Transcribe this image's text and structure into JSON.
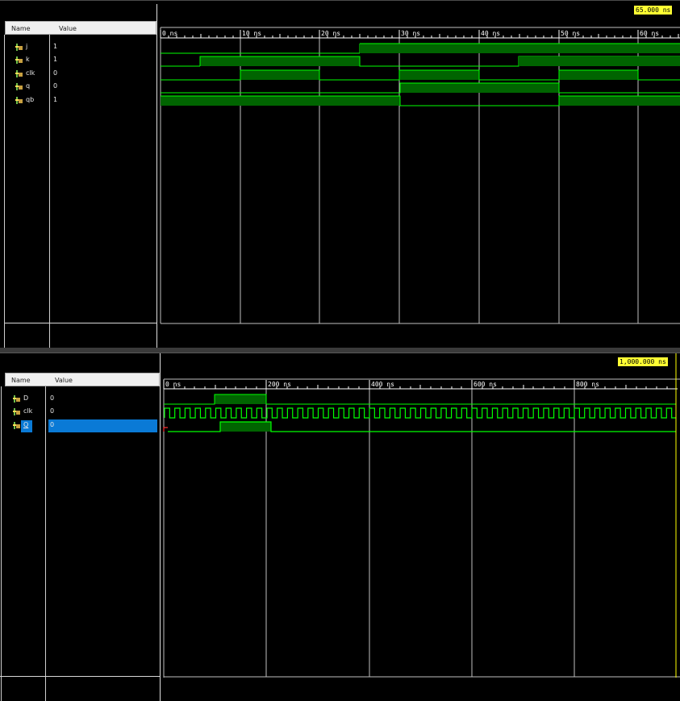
{
  "jk_panel": {
    "headers": {
      "name": "Name",
      "value": "Value"
    },
    "cursor_label": "65.000 ns",
    "time_ticks": [
      "0 ns",
      "10 ns",
      "20 ns",
      "30 ns",
      "40 ns",
      "50 ns",
      "60 ns"
    ],
    "signals": [
      {
        "name": "j",
        "value": "1"
      },
      {
        "name": "k",
        "value": "1"
      },
      {
        "name": "clk",
        "value": "0"
      },
      {
        "name": "q",
        "value": "0"
      },
      {
        "name": "qb",
        "value": "1"
      }
    ]
  },
  "d_panel": {
    "headers": {
      "name": "Name",
      "value": "Value"
    },
    "cursor_label": "1,000.000 ns",
    "time_ticks": [
      "0 ns",
      "200 ns",
      "400 ns",
      "600 ns",
      "800 ns"
    ],
    "signals": [
      {
        "name": "D",
        "value": "0"
      },
      {
        "name": "clk",
        "value": "0"
      },
      {
        "name": "Q",
        "value": "0",
        "selected": true
      }
    ]
  },
  "colors": {
    "wave_high_fill": "#006400",
    "wave_line": "#00ff00",
    "cursor": "#ffff00",
    "selection": "#0a7ad6",
    "grid": "#c0c0c0"
  },
  "icons": [
    "signal-icon"
  ]
}
